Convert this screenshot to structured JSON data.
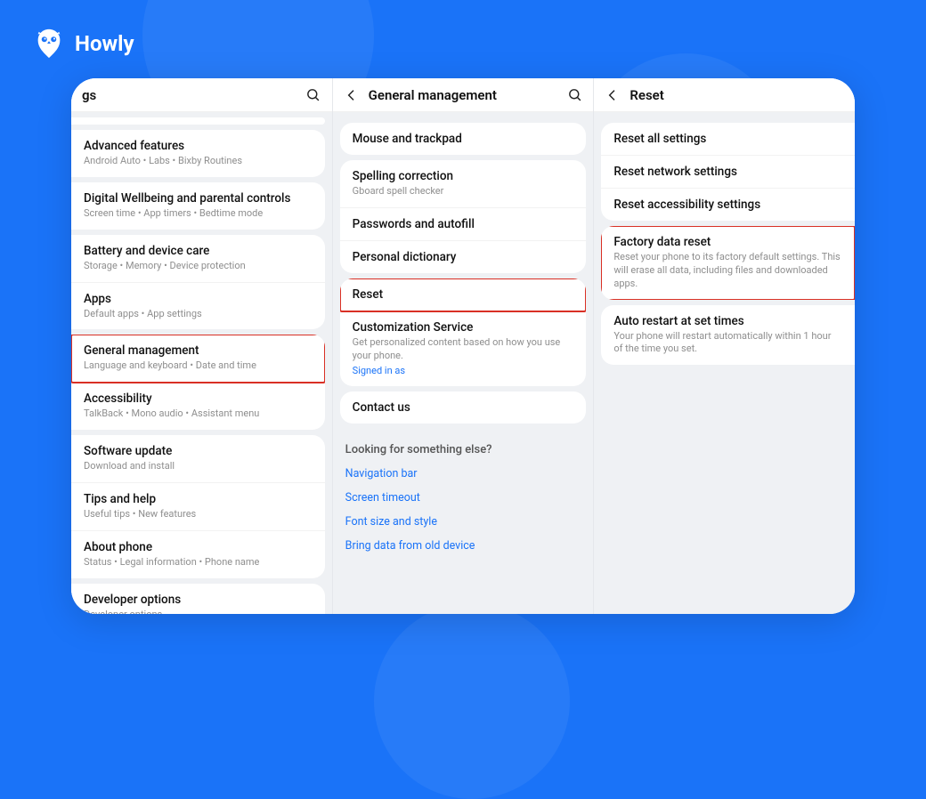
{
  "brand": {
    "name": "Howly"
  },
  "pane1": {
    "header_title_partial": "gs",
    "items": [
      {
        "title": "Advanced features",
        "sub": "Android Auto  •  Labs  •  Bixby Routines"
      },
      {
        "title": "Digital Wellbeing and parental controls",
        "sub": "Screen time  •  App timers  •  Bedtime mode"
      },
      {
        "title": "Battery and device care",
        "sub": "Storage  •  Memory  •  Device protection"
      },
      {
        "title": "Apps",
        "sub": "Default apps  •  App settings"
      },
      {
        "title": "General management",
        "sub": "Language and keyboard  •  Date and time",
        "highlight": true
      },
      {
        "title": "Accessibility",
        "sub": "TalkBack  •  Mono audio  •  Assistant menu"
      },
      {
        "title": "Software update",
        "sub": "Download and install"
      },
      {
        "title": "Tips and help",
        "sub": "Useful tips  •  New features"
      },
      {
        "title": "About phone",
        "sub": "Status  •  Legal information  •  Phone name"
      },
      {
        "title": "Developer options",
        "sub": "Developer options"
      }
    ]
  },
  "pane2": {
    "header_title": "General management",
    "group1": [
      {
        "title": "Mouse and trackpad"
      }
    ],
    "group2": [
      {
        "title": "Spelling correction",
        "sub": "Gboard spell checker"
      },
      {
        "title": "Passwords and autofill"
      },
      {
        "title": "Personal dictionary"
      }
    ],
    "group3": [
      {
        "title": "Reset",
        "highlight": true
      },
      {
        "title": "Customization Service",
        "sub": "Get personalized content based on how you use your phone.",
        "sub2": "Signed in as"
      }
    ],
    "group4": [
      {
        "title": "Contact us"
      }
    ],
    "looking_title": "Looking for something else?",
    "links": [
      "Navigation bar",
      "Screen timeout",
      "Font size and style",
      "Bring data from old device"
    ]
  },
  "pane3": {
    "header_title": "Reset",
    "group1": [
      {
        "title": "Reset all settings"
      },
      {
        "title": "Reset network settings"
      },
      {
        "title": "Reset accessibility settings"
      }
    ],
    "group2": [
      {
        "title": "Factory data reset",
        "sub": "Reset your phone to its factory default settings. This will erase all data, including files and downloaded apps.",
        "highlight": true
      }
    ],
    "group3": [
      {
        "title": "Auto restart at set times",
        "sub": "Your phone will restart automatically within 1 hour of the time you set."
      }
    ]
  }
}
